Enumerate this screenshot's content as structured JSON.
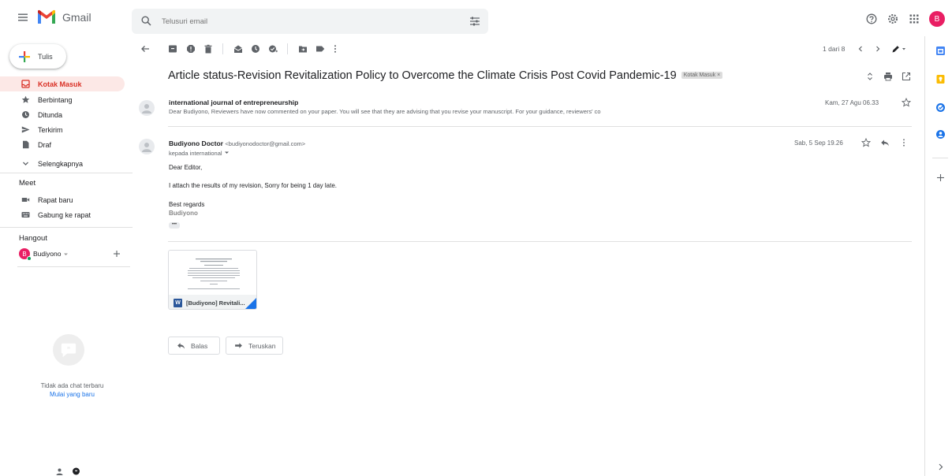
{
  "app": {
    "name": "Gmail"
  },
  "search": {
    "placeholder": "Telusuri email"
  },
  "account": {
    "initial": "B"
  },
  "compose": {
    "label": "Tulis"
  },
  "nav": [
    {
      "label": "Kotak Masuk",
      "icon": "inbox-icon",
      "active": true
    },
    {
      "label": "Berbintang",
      "icon": "star-icon"
    },
    {
      "label": "Ditunda",
      "icon": "clock-icon"
    },
    {
      "label": "Terkirim",
      "icon": "send-icon"
    },
    {
      "label": "Draf",
      "icon": "draft-icon"
    },
    {
      "label": "Selengkapnya",
      "icon": "chevron-down-icon"
    }
  ],
  "meet": {
    "title": "Meet",
    "items": [
      {
        "label": "Rapat baru",
        "icon": "video-icon"
      },
      {
        "label": "Gabung ke rapat",
        "icon": "keyboard-icon"
      }
    ]
  },
  "hangout": {
    "title": "Hangout",
    "user": "Budiyono",
    "user_initial": "B",
    "no_chat": "Tidak ada chat terbaru",
    "start_new": "Mulai yang baru"
  },
  "toolbar": {
    "pager": "1 dari 8"
  },
  "email": {
    "subject": "Article status-Revision Revitalization Policy to Overcome the Climate Crisis Post Covid Pandemic-19",
    "label": "Kotak Masuk",
    "label_close": "×",
    "messages": [
      {
        "sender": "international journal of entrepreneurship",
        "snippet": "Dear Budiyono, Reviewers have now commented on your paper. You will see that they are advising that you revise your manuscript. For your guidance, reviewers' co",
        "date": "Kam, 27 Agu 06.33"
      },
      {
        "sender": "Budiyono Doctor",
        "email": "<budiyonodoctor@gmail.com>",
        "to": "kepada international",
        "date": "Sab, 5 Sep 19.26",
        "greeting": "Dear Editor,",
        "body": "I attach the results of my revision, Sorry for being 1 day late.",
        "closing": "Best regards",
        "signature": "Budiyono",
        "more": "•••"
      }
    ],
    "attachment": {
      "name": "[Budiyono] Revitali...",
      "type_initial": "W"
    },
    "reply_label": "Balas",
    "forward_label": "Teruskan"
  },
  "colors": {
    "accent_red": "#d93025",
    "active_bg": "#fce8e6",
    "link_blue": "#1a73e8",
    "avatar_pink": "#e91e63",
    "word_blue": "#2b579a"
  }
}
